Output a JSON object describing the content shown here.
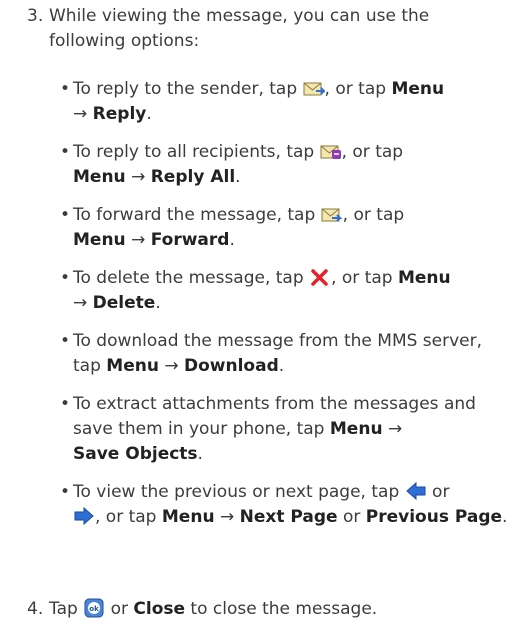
{
  "step3": {
    "number": "3.",
    "intro": "While viewing the message, you can use the following options:"
  },
  "bullets": {
    "reply": {
      "pre": "To reply to the sender, tap ",
      "post": ", or tap ",
      "menu": "Menu",
      "arrow": "→",
      "item": "Reply",
      "end": "."
    },
    "reply_all": {
      "pre": "To reply to all recipients, tap ",
      "post": ", or tap ",
      "menu": "Menu",
      "arrow": "→",
      "item": "Reply All",
      "end": "."
    },
    "forward": {
      "pre": "To forward the message, tap ",
      "post": ", or tap ",
      "menu": "Menu",
      "arrow": "→",
      "item": "Forward",
      "end": "."
    },
    "delete": {
      "pre": "To delete the message, tap ",
      "post": ", or tap ",
      "menu": "Menu",
      "arrow": "→",
      "item": "Delete",
      "end": "."
    },
    "download": {
      "pre": "To download the message from the MMS server, tap ",
      "menu": "Menu",
      "arrow": "→",
      "item": "Download",
      "end": "."
    },
    "save": {
      "pre": "To extract attachments from the messages and save them in your phone, tap ",
      "menu": "Menu",
      "arrow": "→",
      "item": "Save Objects",
      "end": "."
    },
    "page": {
      "pre": "To view the previous or next page, tap ",
      "or": " or ",
      "post": ", or tap ",
      "menu": "Menu",
      "arrow": "→",
      "item": "Next Page",
      "or2": " or ",
      "item2": "Previous Page",
      "end": "."
    }
  },
  "step4": {
    "number": "4.",
    "pre": "Tap ",
    "or": " or ",
    "close": "Close",
    "post": " to close the message."
  },
  "icons": {
    "reply": "envelope-reply-icon",
    "reply_all": "envelope-reply-all-icon",
    "forward": "envelope-forward-icon",
    "delete": "red-x-delete-icon",
    "prev": "blue-left-arrow-icon",
    "next": "blue-right-arrow-icon",
    "ok": "ok-button-icon"
  },
  "colors": {
    "text": "#3c3c3c",
    "delete_red": "#e8202a",
    "arrow_blue": "#2e6fd6"
  }
}
